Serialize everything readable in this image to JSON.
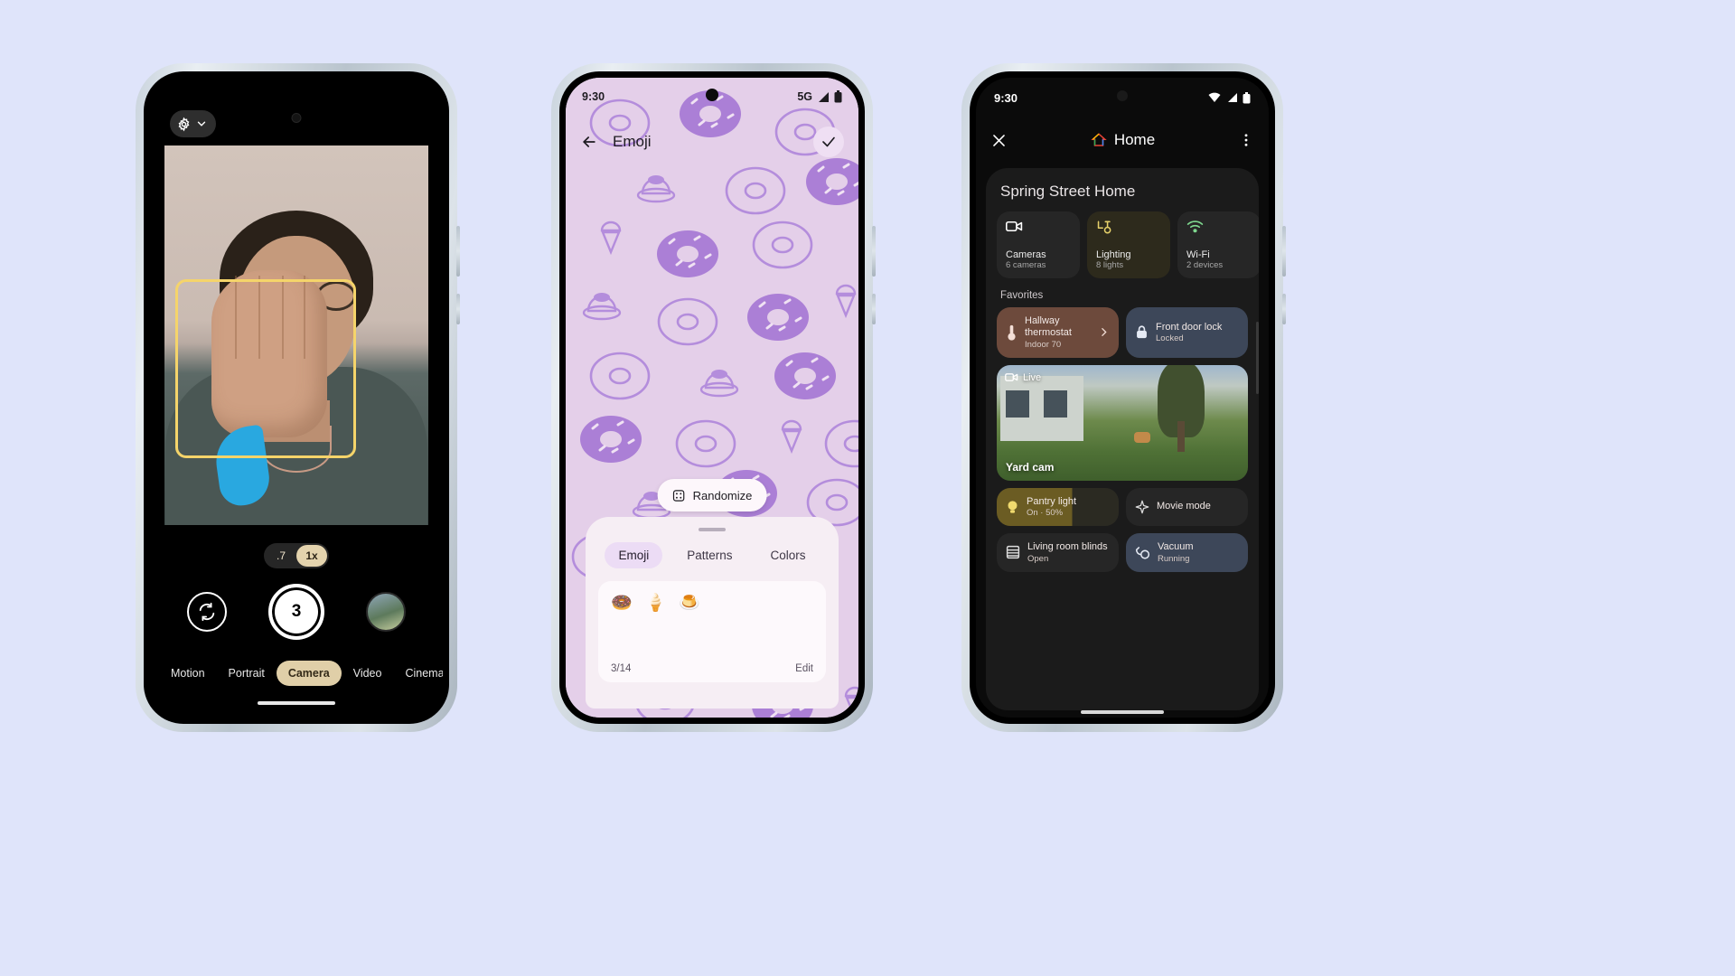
{
  "background_color": "#dfe4fa",
  "phones": {
    "camera": {
      "name": "Pixel camera app",
      "settings_icon": "gear-icon",
      "expand_icon": "chevron-down-icon",
      "zoom_levels": [
        {
          "label": ".7",
          "active": false
        },
        {
          "label": "1x",
          "active": true
        }
      ],
      "controls": {
        "flip_camera_icon": "camera-flip-icon",
        "shutter_label": "3",
        "shutter_name": "timer-shutter-button",
        "gallery_thumb": "gallery-thumbnail"
      },
      "modes": [
        {
          "label": "Motion",
          "active": false
        },
        {
          "label": "Portrait",
          "active": false
        },
        {
          "label": "Camera",
          "active": true
        },
        {
          "label": "Video",
          "active": false
        },
        {
          "label": "Cinemati",
          "active": false
        }
      ]
    },
    "wallpaper": {
      "name": "Wallpaper emoji editor",
      "status": {
        "time": "9:30",
        "network": "5G",
        "signal_icon": "signal-bars-icon",
        "battery_icon": "battery-full-icon"
      },
      "appbar": {
        "back_icon": "back-arrow-icon",
        "title": "Emoji",
        "confirm_icon": "check-icon"
      },
      "randomize": {
        "label": "Randomize",
        "icon": "dice-icon"
      },
      "sheet": {
        "tabs": [
          {
            "label": "Emoji",
            "active": true
          },
          {
            "label": "Patterns",
            "active": false
          },
          {
            "label": "Colors",
            "active": false
          }
        ],
        "emoji": [
          "🍩",
          "🍦",
          "🍮"
        ],
        "counter": "3/14",
        "edit_label": "Edit"
      }
    },
    "home": {
      "name": "Google Home app",
      "status": {
        "time": "9:30",
        "wifi_icon": "wifi-icon",
        "signal_icon": "signal-bars-icon",
        "battery_icon": "battery-full-icon"
      },
      "appbar": {
        "close_icon": "close-icon",
        "title": "Home",
        "logo_icon": "google-home-logo",
        "overflow_icon": "more-vertical-icon"
      },
      "home_name": "Spring Street Home",
      "chips": [
        {
          "label": "Cameras",
          "sub": "6 cameras",
          "icon": "video-camera-icon",
          "accent": "#ffffff"
        },
        {
          "label": "Lighting",
          "sub": "8 lights",
          "icon": "lamp-icon",
          "accent": "#e6d16a"
        },
        {
          "label": "Wi-Fi",
          "sub": "2 devices",
          "icon": "wifi-icon",
          "accent": "#7fd88f"
        }
      ],
      "favorites_label": "Favorites",
      "favorites": [
        {
          "title": "Hallway thermostat",
          "sub": "Indoor 70",
          "icon": "thermostat-icon",
          "chevron": true,
          "color": "#6d4a3c"
        },
        {
          "title": "Front door lock",
          "sub": "Locked",
          "icon": "lock-icon",
          "color": "#3d4759"
        }
      ],
      "camera_card": {
        "live_label": "Live",
        "live_icon": "video-camera-icon",
        "name": "Yard cam"
      },
      "tiles": [
        {
          "title": "Pantry light",
          "sub": "On · 50%",
          "icon": "bulb-icon"
        },
        {
          "title": "Movie mode",
          "sub": "",
          "icon": "sparkle-icon"
        },
        {
          "title": "Living room blinds",
          "sub": "Open",
          "icon": "blinds-icon"
        },
        {
          "title": "Vacuum",
          "sub": "Running",
          "icon": "vacuum-icon"
        }
      ]
    }
  }
}
